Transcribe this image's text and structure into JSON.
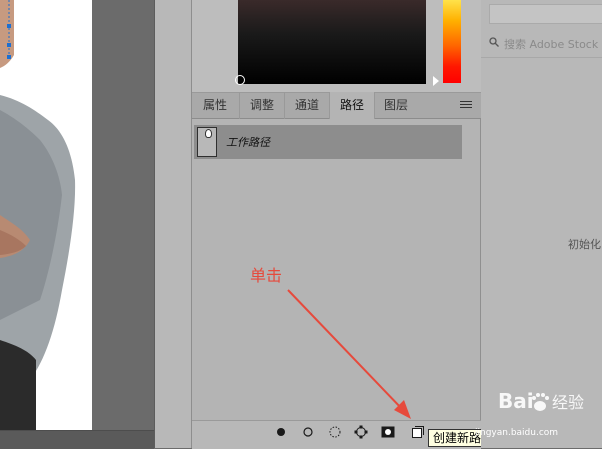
{
  "tabs": [
    {
      "label": "属性"
    },
    {
      "label": "调整"
    },
    {
      "label": "通道"
    },
    {
      "label": "路径"
    },
    {
      "label": "图层"
    }
  ],
  "active_tab": "路径",
  "paths_panel": {
    "path_name": "工作路径"
  },
  "annotation": {
    "text": "单击",
    "color": "#e64a3c"
  },
  "toolbar": {
    "tools": [
      {
        "icon": "fill-path-icon"
      },
      {
        "icon": "stroke-path-icon"
      },
      {
        "icon": "load-selection-icon"
      },
      {
        "icon": "make-work-path-icon"
      },
      {
        "icon": "add-mask-icon"
      },
      {
        "icon": "create-new-path-icon"
      },
      {
        "icon": "delete-path-icon"
      }
    ],
    "tooltip": "创建新路径"
  },
  "library": {
    "search_placeholder": "搜索 Adobe Stock",
    "loading_text": "初始化"
  },
  "watermark": {
    "brand_left": "Bai",
    "brand_right": "经验",
    "url": "jingyan.baidu.com"
  },
  "colors": {
    "accent": "#e64a3c",
    "panel_bg": "#b4b4b4",
    "selected_row": "#8d8d8d"
  }
}
